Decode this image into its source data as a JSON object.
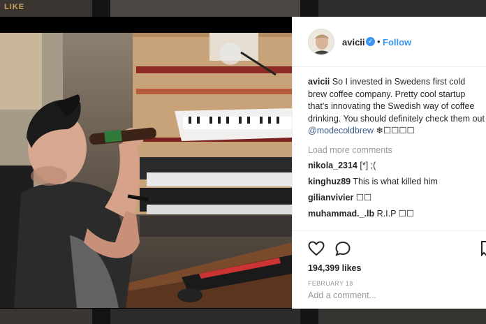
{
  "background": {
    "tile_label": "LIKE"
  },
  "post": {
    "username": "avicii",
    "follow_label": "Follow",
    "separator": "•",
    "verified_mark": "✓",
    "caption": {
      "user": "avicii",
      "text": "So I invested in Swedens first cold brew coffee company. Pretty cool startup that's innovating the Swedish way of coffee drinking. You should definitely check them out",
      "mention": "@modecoldbrew",
      "trailing": "❄☐☐☐☐"
    },
    "load_more_label": "Load more comments",
    "comments": [
      {
        "user": "nikola_2314",
        "text": "[*] ;("
      },
      {
        "user": "kinghuz89",
        "text": "This is what killed him"
      },
      {
        "user": "gilianvivier",
        "text": "☐☐"
      },
      {
        "user": "muhammad._.lb",
        "text": "R.I.P ☐☐"
      }
    ],
    "likes": "194,399 likes",
    "date": "FEBRUARY 18",
    "add_comment_placeholder": "Add a comment..."
  },
  "icons": {
    "like": "heart-icon",
    "comment": "comment-bubble-icon",
    "save": "bookmark-icon",
    "verified": "verified-badge-icon"
  },
  "colors": {
    "accent": "#3897f0",
    "text": "#262626",
    "muted": "#999999",
    "mention": "#3d5a8a"
  }
}
